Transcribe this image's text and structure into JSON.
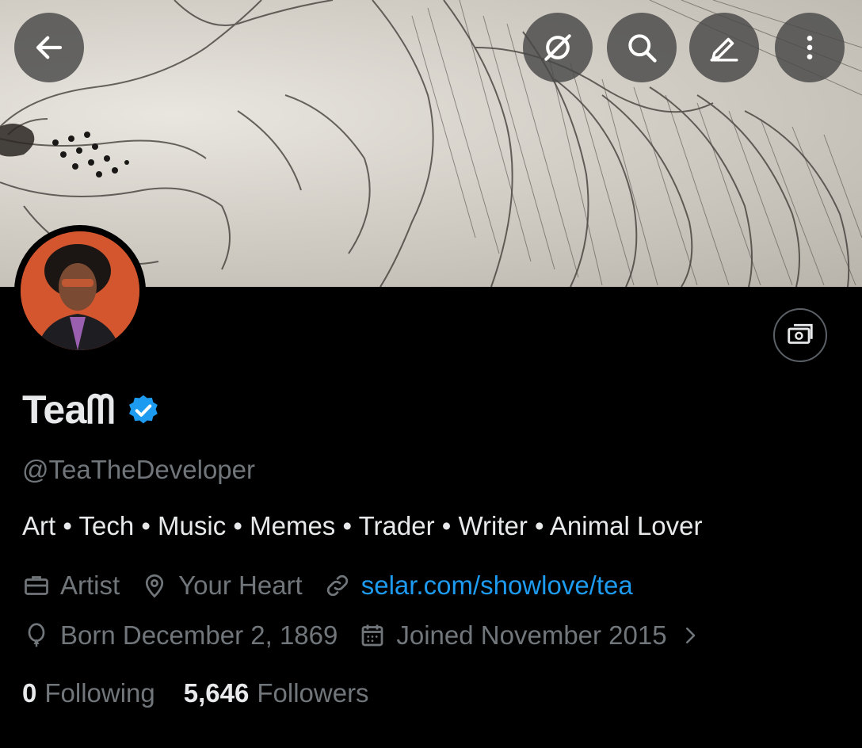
{
  "header": {
    "back_icon": "arrow-left-icon",
    "actions": [
      "no-grok-icon",
      "search-icon",
      "edit-icon",
      "more-vertical-icon"
    ]
  },
  "profile": {
    "display_name": "Teaᗰ",
    "verified": true,
    "handle": "@TeaTheDeveloper",
    "bio": "Art • Tech • Music • Memes • Trader • Writer • Animal Lover",
    "profession": "Artist",
    "location": "Your Heart",
    "website": "selar.com/showlove/tea",
    "born": "Born December 2, 1869",
    "joined": "Joined November 2015",
    "following_count": "0",
    "following_label": "Following",
    "followers_count": "5,646",
    "followers_label": "Followers"
  },
  "colors": {
    "background": "#000000",
    "text_primary": "#e7e9ea",
    "text_secondary": "#71767b",
    "link": "#1d9bf0",
    "verified": "#1d9bf0"
  }
}
